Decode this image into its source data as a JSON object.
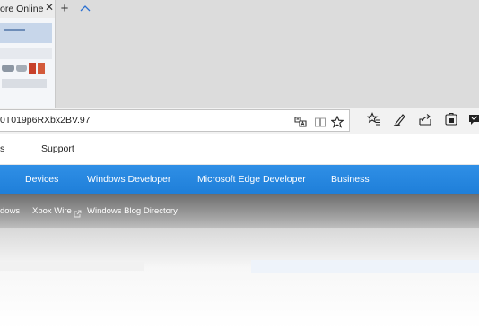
{
  "browser": {
    "tab": {
      "title": "ore Online - We",
      "close_glyph": "✕"
    },
    "new_tab_glyph": "+",
    "tab_preview_chevron_icon": "chevron-up-icon",
    "address": {
      "url": "0T019p6RXbx2BV.97"
    },
    "address_buttons": [
      {
        "name": "translate-icon"
      },
      {
        "name": "reading-view-icon"
      },
      {
        "name": "favorite-star-icon"
      }
    ],
    "toolbar_buttons": [
      {
        "name": "favorites-hub-icon"
      },
      {
        "name": "web-note-icon"
      },
      {
        "name": "share-icon"
      },
      {
        "name": "extension-icon"
      },
      {
        "name": "feedback-icon"
      }
    ]
  },
  "site": {
    "nav": {
      "partial_item": "s",
      "support": "Support"
    },
    "categories": [
      "Devices",
      "Windows Developer",
      "Microsoft Edge Developer",
      "Business"
    ],
    "blogs": {
      "partial_item": "dows",
      "xbox": "Xbox Wire",
      "directory": "Windows Blog Directory"
    }
  },
  "colors": {
    "accent_blue": "#2387e0",
    "gray_bar": "#8a8a8a",
    "tab_strip": "#dcdcdc"
  }
}
